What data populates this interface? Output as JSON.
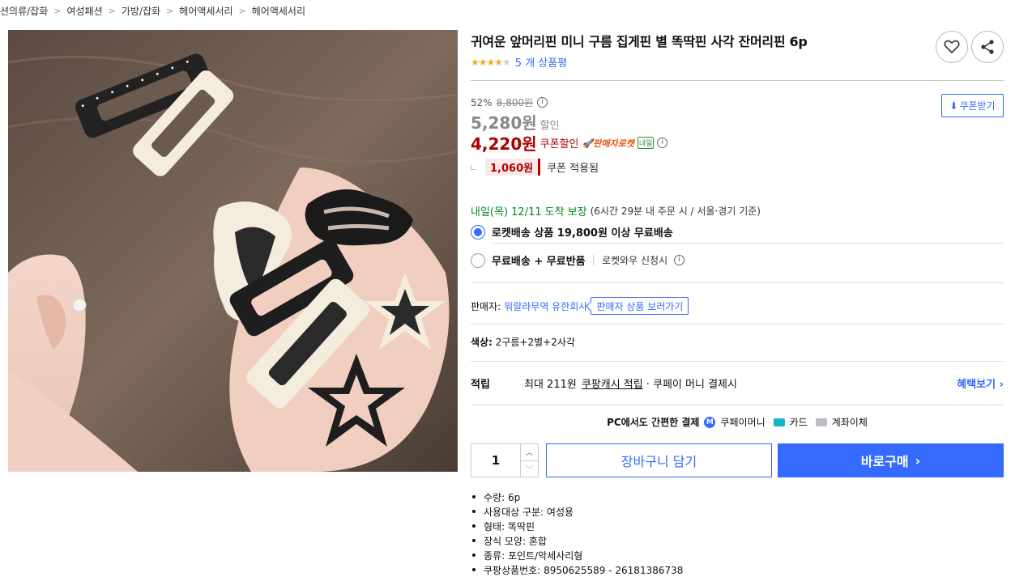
{
  "breadcrumb": [
    "션의류/잡화",
    "여성패션",
    "가방/잡화",
    "헤어액세서리",
    "헤어액세서리"
  ],
  "product": {
    "title": "귀여운 앞머리핀 미니 구름 집게핀 별 똑딱핀 사각 잔머리핀 6p",
    "rating": 4,
    "rating_max": 5,
    "review_count": "5 개 상품평"
  },
  "price": {
    "discount_rate": "52%",
    "original": "8,800원",
    "sale": "5,280원",
    "sale_label": "할인",
    "coupon": "4,220원",
    "coupon_label": "쿠폰할인",
    "rocket_badge": "판매자로켓",
    "rocket_day_badge": "내일",
    "coupon_save": "1,060원",
    "coupon_save_label": "쿠폰 적용됨",
    "coupon_button": "쿠폰받기"
  },
  "delivery": {
    "date": "내일(목) 12/11",
    "guarantee": "도착 보장",
    "note": "(6시간 29분 내 주문 시 / 서울·경기 기준)",
    "option1": "로켓배송 상품 19,800원 이상 무료배송",
    "option2_main": "무료배송 + 무료반품",
    "option2_sub": "로켓와우 신청시"
  },
  "seller": {
    "label": "판매자:",
    "name": "워랄라무역 유한회사",
    "link": "판매자 상품 보러가기"
  },
  "color": {
    "label": "색상:",
    "value": "2구름+2별+2사각"
  },
  "reward": {
    "label": "적립",
    "text": "최대 211원",
    "cash": "쿠팡캐시 적립",
    "suffix": "· 쿠페이 머니 결제시",
    "more": "혜택보기"
  },
  "payment": {
    "title": "PC에서도 간편한 결제",
    "methods": [
      "쿠페이머니",
      "카드",
      "계좌이체"
    ]
  },
  "purchase": {
    "quantity": "1",
    "cart": "장바구니 담기",
    "buy": "바로구매"
  },
  "attributes": [
    "수량: 6p",
    "사용대상 구분: 여성용",
    "형태: 똑딱핀",
    "장식 모양: 혼합",
    "종류: 포인트/악세사리형",
    "쿠팡상품번호: 8950625589 - 26181386738"
  ],
  "colors": {
    "accent": "#346aff",
    "price_red": "#ae0000",
    "green": "#00891a",
    "star": "#f5a623"
  }
}
